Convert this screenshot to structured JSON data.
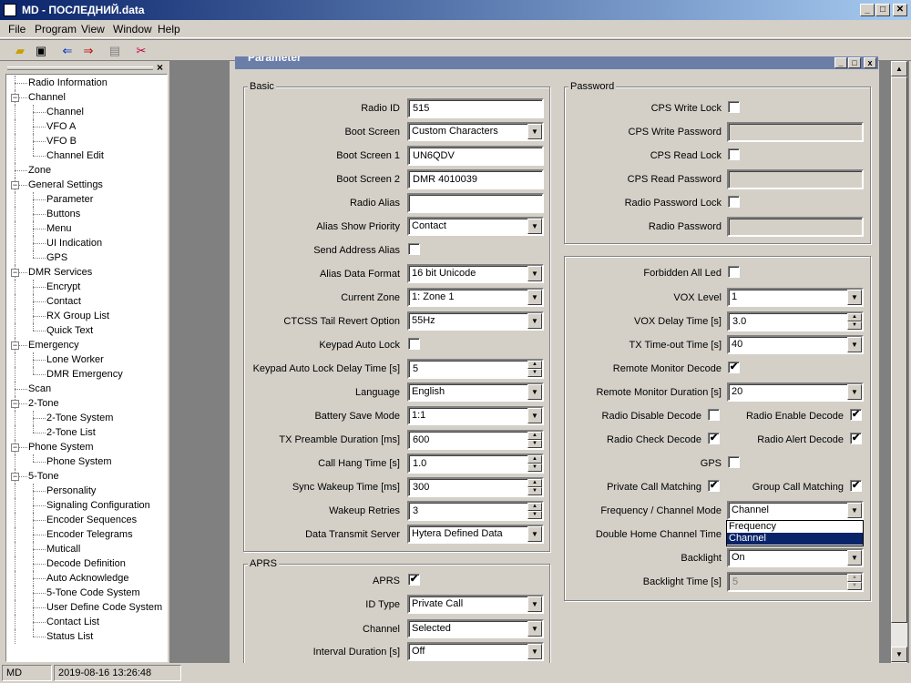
{
  "window": {
    "title": "MD - ПОСЛЕДНИЙ.data",
    "min": "_",
    "max": "□",
    "close": "✕"
  },
  "menu": [
    "File",
    "Program",
    "View",
    "Window",
    "Help"
  ],
  "toolbar": [
    "open-icon",
    "save-icon",
    "read-radio-icon",
    "write-radio-icon",
    "print-icon",
    "cut-icon"
  ],
  "tree": [
    {
      "label": "Radio Information",
      "level": 0
    },
    {
      "label": "Channel",
      "level": 0,
      "exp": true
    },
    {
      "label": "Channel",
      "level": 1
    },
    {
      "label": "VFO A",
      "level": 1
    },
    {
      "label": "VFO B",
      "level": 1
    },
    {
      "label": "Channel Edit",
      "level": 1
    },
    {
      "label": "Zone",
      "level": 0
    },
    {
      "label": "General Settings",
      "level": 0,
      "exp": true
    },
    {
      "label": "Parameter",
      "level": 1
    },
    {
      "label": "Buttons",
      "level": 1
    },
    {
      "label": "Menu",
      "level": 1
    },
    {
      "label": "UI Indication",
      "level": 1
    },
    {
      "label": "GPS",
      "level": 1
    },
    {
      "label": "DMR Services",
      "level": 0,
      "exp": true
    },
    {
      "label": "Encrypt",
      "level": 1
    },
    {
      "label": "Contact",
      "level": 1
    },
    {
      "label": "RX Group List",
      "level": 1
    },
    {
      "label": "Quick Text",
      "level": 1
    },
    {
      "label": "Emergency",
      "level": 0,
      "exp": true
    },
    {
      "label": "Lone Worker",
      "level": 1
    },
    {
      "label": "DMR Emergency",
      "level": 1
    },
    {
      "label": "Scan",
      "level": 0
    },
    {
      "label": "2-Tone",
      "level": 0,
      "exp": true
    },
    {
      "label": "2-Tone System",
      "level": 1
    },
    {
      "label": "2-Tone List",
      "level": 1
    },
    {
      "label": "Phone System",
      "level": 0,
      "exp": true
    },
    {
      "label": "Phone System",
      "level": 1
    },
    {
      "label": "5-Tone",
      "level": 0,
      "exp": true
    },
    {
      "label": "Personality",
      "level": 1
    },
    {
      "label": "Signaling Configuration",
      "level": 1
    },
    {
      "label": "Encoder Sequences",
      "level": 1
    },
    {
      "label": "Encoder Telegrams",
      "level": 1
    },
    {
      "label": "Muticall",
      "level": 1
    },
    {
      "label": "Decode Definition",
      "level": 1
    },
    {
      "label": "Auto Acknowledge",
      "level": 1
    },
    {
      "label": "5-Tone Code System",
      "level": 1
    },
    {
      "label": "User Define Code System",
      "level": 1
    },
    {
      "label": "Contact List",
      "level": 1
    },
    {
      "label": "Status List",
      "level": 1
    }
  ],
  "child_title": "Parameter",
  "basic": {
    "title": "Basic",
    "fields": [
      {
        "label": "Radio ID",
        "type": "text",
        "value": "515"
      },
      {
        "label": "Boot Screen",
        "type": "combo",
        "value": "Custom Characters"
      },
      {
        "label": "Boot Screen 1",
        "type": "text",
        "value": "UN6QDV"
      },
      {
        "label": "Boot Screen 2",
        "type": "text",
        "value": "DMR 4010039"
      },
      {
        "label": "Radio Alias",
        "type": "text",
        "value": ""
      },
      {
        "label": "Alias Show Priority",
        "type": "combo",
        "value": "Contact"
      },
      {
        "label": "Send Address Alias",
        "type": "check",
        "value": ""
      },
      {
        "label": "Alias Data Format",
        "type": "combo",
        "value": "16 bit Unicode"
      },
      {
        "label": "Current Zone",
        "type": "combo",
        "value": "1: Zone 1"
      },
      {
        "label": "CTCSS Tail Revert Option",
        "type": "combo",
        "value": "55Hz"
      },
      {
        "label": "Keypad Auto Lock",
        "type": "check",
        "value": ""
      },
      {
        "label": "Keypad Auto Lock Delay Time [s]",
        "type": "spin",
        "value": "5"
      },
      {
        "label": "Language",
        "type": "combo",
        "value": "English"
      },
      {
        "label": "Battery Save Mode",
        "type": "combo",
        "value": "1:1"
      },
      {
        "label": "TX Preamble Duration [ms]",
        "type": "spin",
        "value": "600"
      },
      {
        "label": "Call Hang Time [s]",
        "type": "spin",
        "value": "1.0"
      },
      {
        "label": "Sync Wakeup Time [ms]",
        "type": "spin",
        "value": "300"
      },
      {
        "label": "Wakeup Retries",
        "type": "spin",
        "value": "3"
      },
      {
        "label": "Data Transmit Server",
        "type": "combo",
        "value": "Hytera Defined Data"
      }
    ]
  },
  "aprs": {
    "title": "APRS",
    "fields": [
      {
        "label": "APRS",
        "type": "check",
        "value": "✔"
      },
      {
        "label": "ID Type",
        "type": "combo",
        "value": "Private Call"
      },
      {
        "label": "Channel",
        "type": "combo",
        "value": "Selected"
      },
      {
        "label": "Interval Duration [s]",
        "type": "combo",
        "value": "Off"
      }
    ]
  },
  "password": {
    "title": "Password",
    "fields": [
      {
        "label": "CPS Write Lock",
        "type": "check",
        "value": ""
      },
      {
        "label": "CPS Write Password",
        "type": "dtext",
        "value": ""
      },
      {
        "label": "CPS Read Lock",
        "type": "check",
        "value": ""
      },
      {
        "label": "CPS Read Password",
        "type": "dtext",
        "value": ""
      },
      {
        "label": "Radio Password Lock",
        "type": "check",
        "value": ""
      },
      {
        "label": "Radio Password",
        "type": "dtext",
        "value": ""
      }
    ]
  },
  "misc": {
    "forbidden_all_led": {
      "label": "Forbidden All Led",
      "value": ""
    },
    "vox_level": {
      "label": "VOX Level",
      "value": "1"
    },
    "vox_delay": {
      "label": "VOX Delay Time [s]",
      "value": "3.0"
    },
    "tx_timeout": {
      "label": "TX Time-out Time [s]",
      "value": "40"
    },
    "remote_monitor_decode": {
      "label": "Remote Monitor Decode",
      "value": "✔"
    },
    "remote_monitor_duration": {
      "label": "Remote Monitor Duration [s]",
      "value": "20"
    },
    "radio_disable_decode": {
      "label": "Radio Disable Decode",
      "value": ""
    },
    "radio_enable_decode": {
      "label": "Radio Enable Decode",
      "value": "✔"
    },
    "radio_check_decode": {
      "label": "Radio Check Decode",
      "value": "✔"
    },
    "radio_alert_decode": {
      "label": "Radio Alert Decode",
      "value": "✔"
    },
    "gps": {
      "label": "GPS",
      "value": ""
    },
    "private_call_matching": {
      "label": "Private Call Matching",
      "value": "✔"
    },
    "group_call_matching": {
      "label": "Group Call Matching",
      "value": "✔"
    },
    "freq_channel_mode": {
      "label": "Frequency / Channel Mode",
      "value": "Channel",
      "options": [
        "Frequency",
        "Channel"
      ]
    },
    "double_home": {
      "label": "Double Home Channel Time"
    },
    "backlight": {
      "label": "Backlight",
      "value": "On"
    },
    "backlight_time": {
      "label": "Backlight Time [s]",
      "value": "5"
    }
  },
  "status": {
    "mode": "MD",
    "datetime": "2019-08-16 13:26:48"
  }
}
